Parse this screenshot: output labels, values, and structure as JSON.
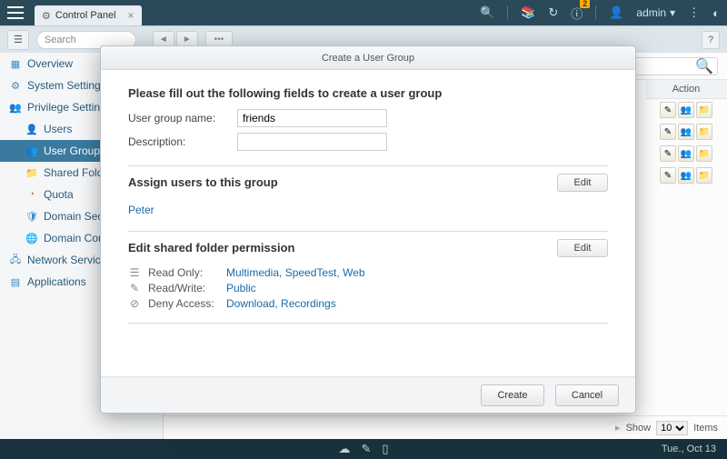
{
  "topbar": {
    "app_tab_label": "Control Panel",
    "notification_count": "2",
    "username": "admin"
  },
  "toolbar": {
    "search_placeholder": "Search"
  },
  "sidebar": {
    "items": [
      {
        "label": "Overview",
        "icon": "grid"
      },
      {
        "label": "System Settings",
        "icon": "gear"
      },
      {
        "label": "Privilege Settings",
        "icon": "user-shield"
      },
      {
        "label": "Users",
        "icon": "user"
      },
      {
        "label": "User Groups",
        "icon": "users"
      },
      {
        "label": "Shared Folders",
        "icon": "folder"
      },
      {
        "label": "Quota",
        "icon": "pie"
      },
      {
        "label": "Domain Security",
        "icon": "shield"
      },
      {
        "label": "Domain Controller",
        "icon": "globe"
      },
      {
        "label": "Network Services",
        "icon": "network"
      },
      {
        "label": "Applications",
        "icon": "apps"
      }
    ]
  },
  "content": {
    "action_header": "Action",
    "pagination": {
      "show_label": "Show",
      "page_size": "10",
      "items_label": "Items"
    }
  },
  "modal": {
    "title": "Create a User Group",
    "intro": "Please fill out the following fields to create a user group",
    "fields": {
      "group_name_label": "User group name:",
      "group_name_value": "friends",
      "description_label": "Description:",
      "description_value": ""
    },
    "assign_section": {
      "title": "Assign users to this group",
      "edit_label": "Edit",
      "users": "Peter"
    },
    "perm_section": {
      "title": "Edit shared folder permission",
      "edit_label": "Edit",
      "read_only_label": "Read Only:",
      "read_only_folders": "Multimedia, SpeedTest, Web",
      "read_write_label": "Read/Write:",
      "read_write_folders": "Public",
      "deny_label": "Deny Access:",
      "deny_folders": "Download, Recordings"
    },
    "buttons": {
      "create": "Create",
      "cancel": "Cancel"
    }
  },
  "bottombar": {
    "date": "Tue., Oct 13"
  }
}
